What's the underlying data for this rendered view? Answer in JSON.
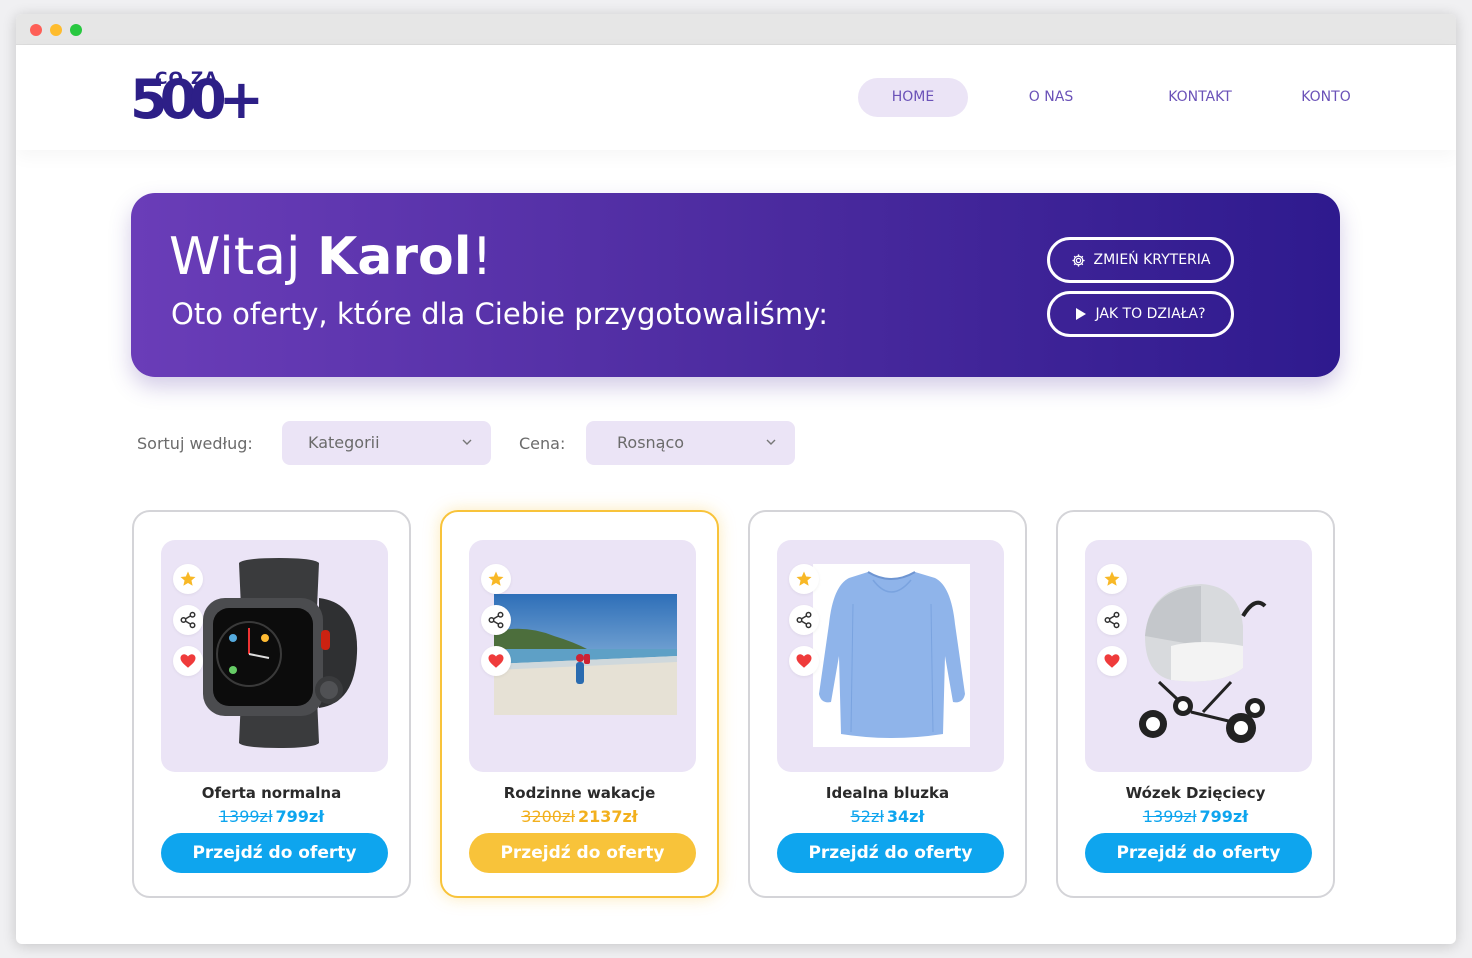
{
  "logo": {
    "small_text": "CO ZA",
    "big_text": "500+"
  },
  "nav": {
    "items": [
      {
        "label": "HOME",
        "active": true
      },
      {
        "label": "O NAS",
        "active": false
      },
      {
        "label": "KONTAKT",
        "active": false
      },
      {
        "label": "KONTO",
        "active": false
      }
    ]
  },
  "hero": {
    "greeting": "Witaj ",
    "name": "Karol",
    "exclamation": "!",
    "subtitle": "Oto oferty, które dla Ciebie przygotowaliśmy:",
    "buttons": [
      {
        "label": "ZMIEŃ KRYTERIA",
        "icon": "gear-icon"
      },
      {
        "label": "JAK TO DZIAŁA?",
        "icon": "play-icon"
      }
    ]
  },
  "filters": {
    "sort_label": "Sortuj według:",
    "sort_value": "Kategorii",
    "price_label": "Cena:",
    "price_value": "Rosnąco"
  },
  "colors": {
    "accent_blue": "#0ea5ee",
    "accent_yellow": "#f8c33a",
    "brand_purple": "#2d1f87",
    "lavender": "#ebe4f6"
  },
  "cards": [
    {
      "title": "Oferta normalna",
      "old_price": "1399zł",
      "new_price": "799zł",
      "cta": "Przejdź do oferty",
      "featured": false,
      "image": "smartwatch"
    },
    {
      "title": "Rodzinne wakacje",
      "old_price": "3200zł",
      "new_price": "2137zł",
      "cta": "Przejdź do oferty",
      "featured": true,
      "image": "beach-photo"
    },
    {
      "title": "Idealna bluzka",
      "old_price": "52zł",
      "new_price": "34zł",
      "cta": "Przejdź do oferty",
      "featured": false,
      "image": "blue-blouse"
    },
    {
      "title": "Wózek Dzięciecy",
      "old_price": "1399zł",
      "new_price": "799zł",
      "cta": "Przejdź do oferty",
      "featured": false,
      "image": "baby-stroller"
    }
  ]
}
